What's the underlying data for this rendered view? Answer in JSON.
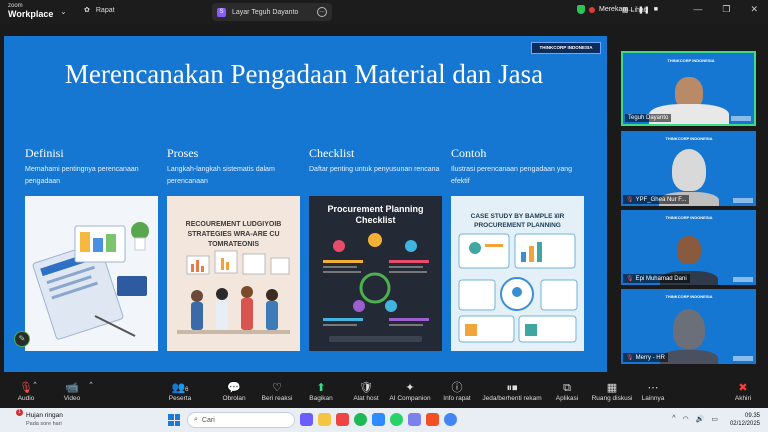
{
  "topbar": {
    "app_brand_line1": "zoom",
    "app_brand_line2": "Workplace",
    "meeting_label": "Rapat",
    "share_tab_label": "Layar Teguh Dayanto",
    "share_badge": "S",
    "recording_label": "Merekam...",
    "view_label": "Lihat",
    "colors": {
      "recording": "#e53935",
      "shield": "#2ec35a"
    }
  },
  "slide": {
    "logo_text": "THINKCORP INDONESIA",
    "title": "Merencanakan Pengadaan Material dan Jasa",
    "columns": [
      {
        "heading": "Definisi",
        "text": "Memahami pentingnya perencanaan pengadaan"
      },
      {
        "heading": "Proses",
        "text": "Langkah-langkah sistematis dalam perencanaan"
      },
      {
        "heading": "Checklist",
        "text": "Daftar penting untuk penyusunan rencana"
      },
      {
        "heading": "Contoh",
        "text": "Ilustrasi perencanaan pengadaan yang efektif"
      }
    ],
    "card_texts": {
      "card2_title": "RECOUREMENT LUDGIYOIB STRATEGIES WRA-ARE CU TOMRATEONIS",
      "card3_title": "Procurement Planning Checklist",
      "card4_title": "CASE STUDY BY BAMPLE ¥IR PROCUREMENT PLANNING"
    },
    "background_color": "#1677d2"
  },
  "participants": [
    {
      "name": "Teguh Dayanto",
      "mic_muted": false,
      "active_speaker": true
    },
    {
      "name": "YPF_Ghea Nur F...",
      "mic_muted": true,
      "active_speaker": false
    },
    {
      "name": "Epi Muhamad Dani",
      "mic_muted": true,
      "active_speaker": false
    },
    {
      "name": "Merry - HR",
      "mic_muted": true,
      "active_speaker": false
    }
  ],
  "toolbar": {
    "audio": "Audio",
    "video": "Video",
    "participants": "Peserta",
    "participant_count": "6",
    "chat": "Obrolan",
    "react": "Beri reaksi",
    "share": "Bagikan",
    "host_tools": "Alat host",
    "ai": "AI Companion",
    "info": "Info rapat",
    "pause_record": "Jeda/berhenti rekam",
    "apps": "Aplikasi",
    "breakout": "Ruang diskusi",
    "more": "Lainnya",
    "end": "Akhiri"
  },
  "taskbar": {
    "weather_title": "Hujan ringan",
    "weather_sub": "Pada sore hari",
    "weather_badge": "1",
    "search_placeholder": "Cari",
    "time": "09.35",
    "date": "02/12/2025"
  }
}
